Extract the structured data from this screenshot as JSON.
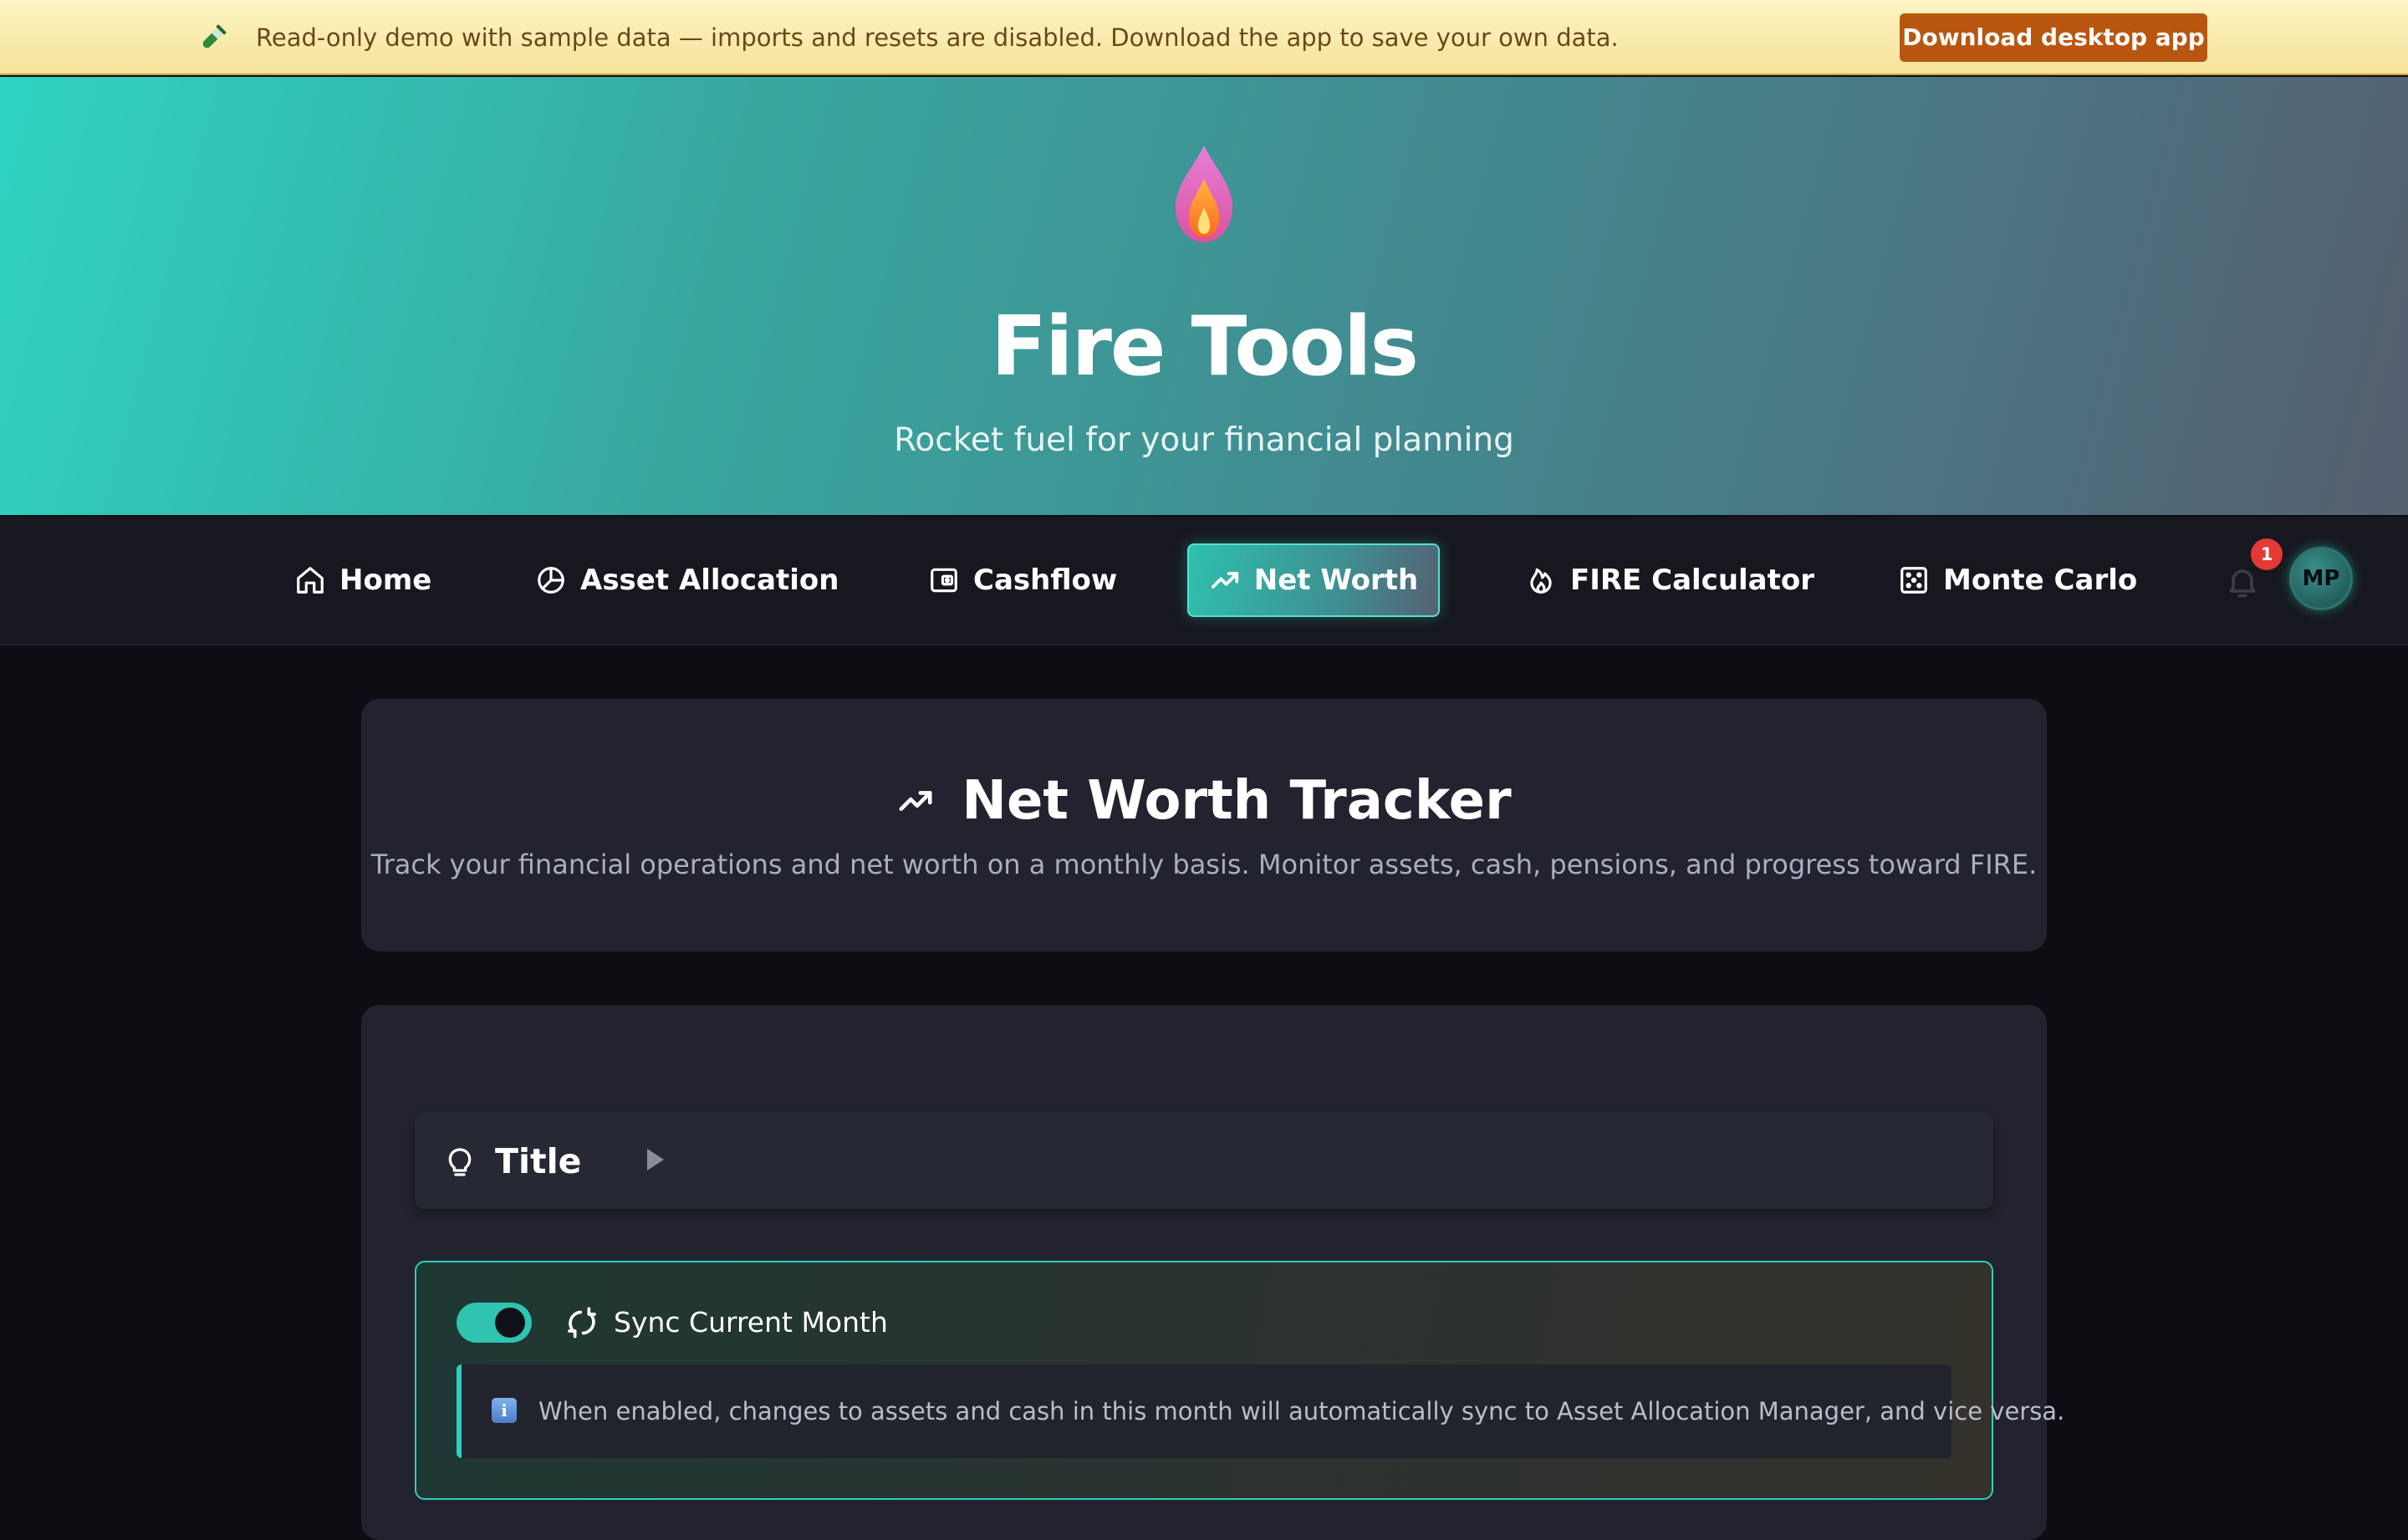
{
  "banner": {
    "icon": "test-tube-icon",
    "text": "Read-only demo with sample data — imports and resets are disabled. Download the app to save your own data.",
    "button_label": "Download desktop app"
  },
  "hero": {
    "logo_icon": "flame-icon",
    "title": "Fire Tools",
    "subtitle": "Rocket fuel for your financial planning"
  },
  "nav": {
    "items": [
      {
        "label": "Home",
        "icon": "home-icon",
        "active": false
      },
      {
        "label": "Asset Allocation",
        "icon": "pie-chart-icon",
        "active": false
      },
      {
        "label": "Cashflow",
        "icon": "wallet-icon",
        "active": false
      },
      {
        "label": "Net Worth",
        "icon": "trending-up-icon",
        "active": true
      },
      {
        "label": "FIRE Calculator",
        "icon": "flame-icon",
        "active": false
      },
      {
        "label": "Monte Carlo",
        "icon": "dice-icon",
        "active": false
      }
    ],
    "notification_count": "1",
    "avatar_initials": "MP"
  },
  "header_card": {
    "title": "Net Worth Tracker",
    "description": "Track your financial operations and net worth on a monthly basis. Monitor assets, cash, pensions, and progress toward FIRE."
  },
  "tips": {
    "label": "Title",
    "expanded": false
  },
  "sync": {
    "enabled": true,
    "label": "Sync Current Month",
    "info_text": "When enabled, changes to assets and cash in this month will automatically sync to Asset Allocation Manager, and vice versa."
  },
  "colors": {
    "accent": "#2fcfbb",
    "banner_button": "#b8560f",
    "badge": "#e53935"
  }
}
